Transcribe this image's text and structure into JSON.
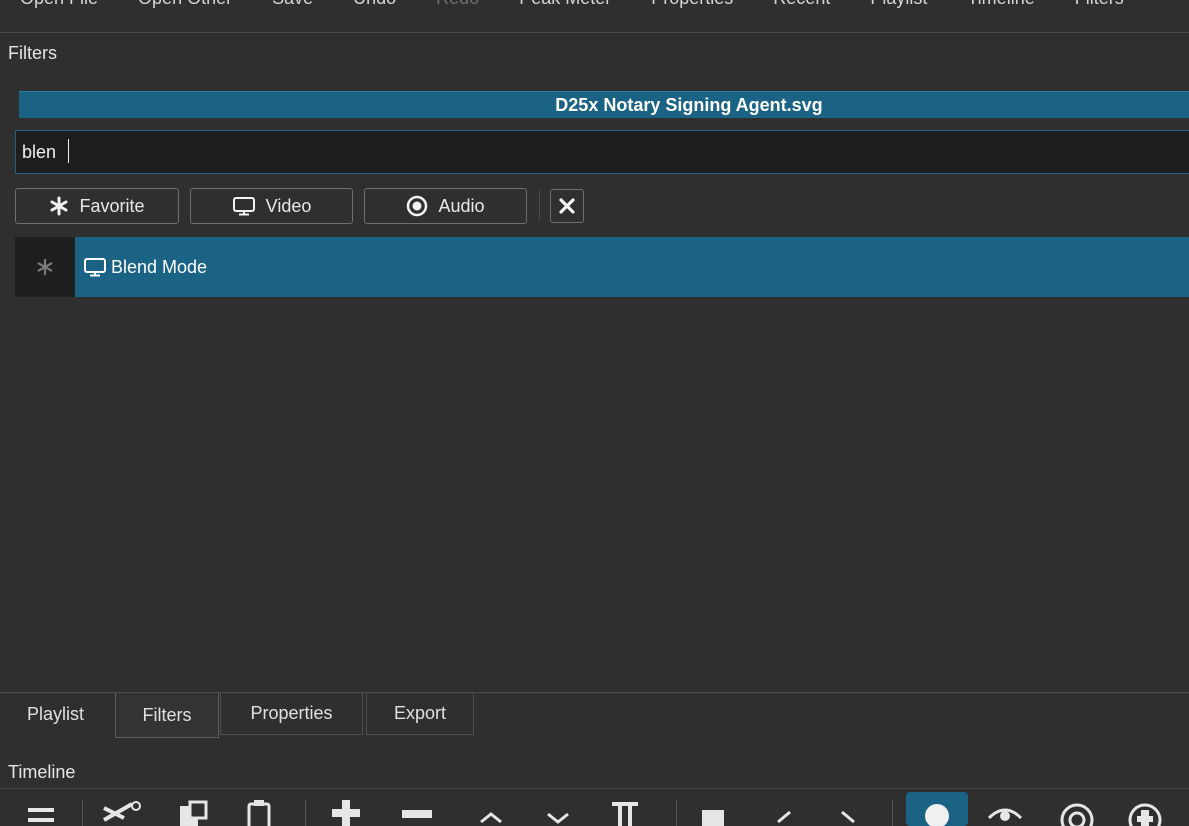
{
  "top_toolbar": {
    "items": [
      {
        "label": "Open File",
        "disabled": false
      },
      {
        "label": "Open Other",
        "disabled": false
      },
      {
        "label": "Save",
        "disabled": false
      },
      {
        "label": "Undo",
        "disabled": false
      },
      {
        "label": "Redo",
        "disabled": true
      },
      {
        "label": "Peak Meter",
        "disabled": false
      },
      {
        "label": "Properties",
        "disabled": false
      },
      {
        "label": "Recent",
        "disabled": false
      },
      {
        "label": "Playlist",
        "disabled": false
      },
      {
        "label": "Timeline",
        "disabled": false
      },
      {
        "label": "Filters",
        "disabled": false
      }
    ]
  },
  "filters_dock": {
    "title": "Filters",
    "clip_name": "D25x Notary Signing Agent.svg",
    "search_value": "blen",
    "buttons": {
      "favorite": "Favorite",
      "video": "Video",
      "audio": "Audio"
    },
    "results": [
      {
        "label": "Blend Mode",
        "type_icon": "monitor-icon",
        "favorite_icon": "star-icon",
        "selected": true
      }
    ]
  },
  "bottom_tabs": [
    "Playlist",
    "Filters",
    "Properties",
    "Export"
  ],
  "active_tab": "Filters",
  "timeline": {
    "title": "Timeline",
    "toolbar_icons": [
      "menu-icon",
      "cut-icon",
      "copy-icon",
      "paste-icon",
      "append-icon",
      "remove-icon",
      "lift-icon",
      "overwrite-icon",
      "split-icon",
      "marker-icon",
      "prev-marker-icon",
      "next-marker-icon",
      "snap-icon",
      "scrub-icon",
      "ripple-icon",
      "ripple-all-icon"
    ]
  },
  "colors": {
    "background": "#2f2f2f",
    "accent": "#1b6384",
    "input_bg": "#1e1e1e"
  }
}
